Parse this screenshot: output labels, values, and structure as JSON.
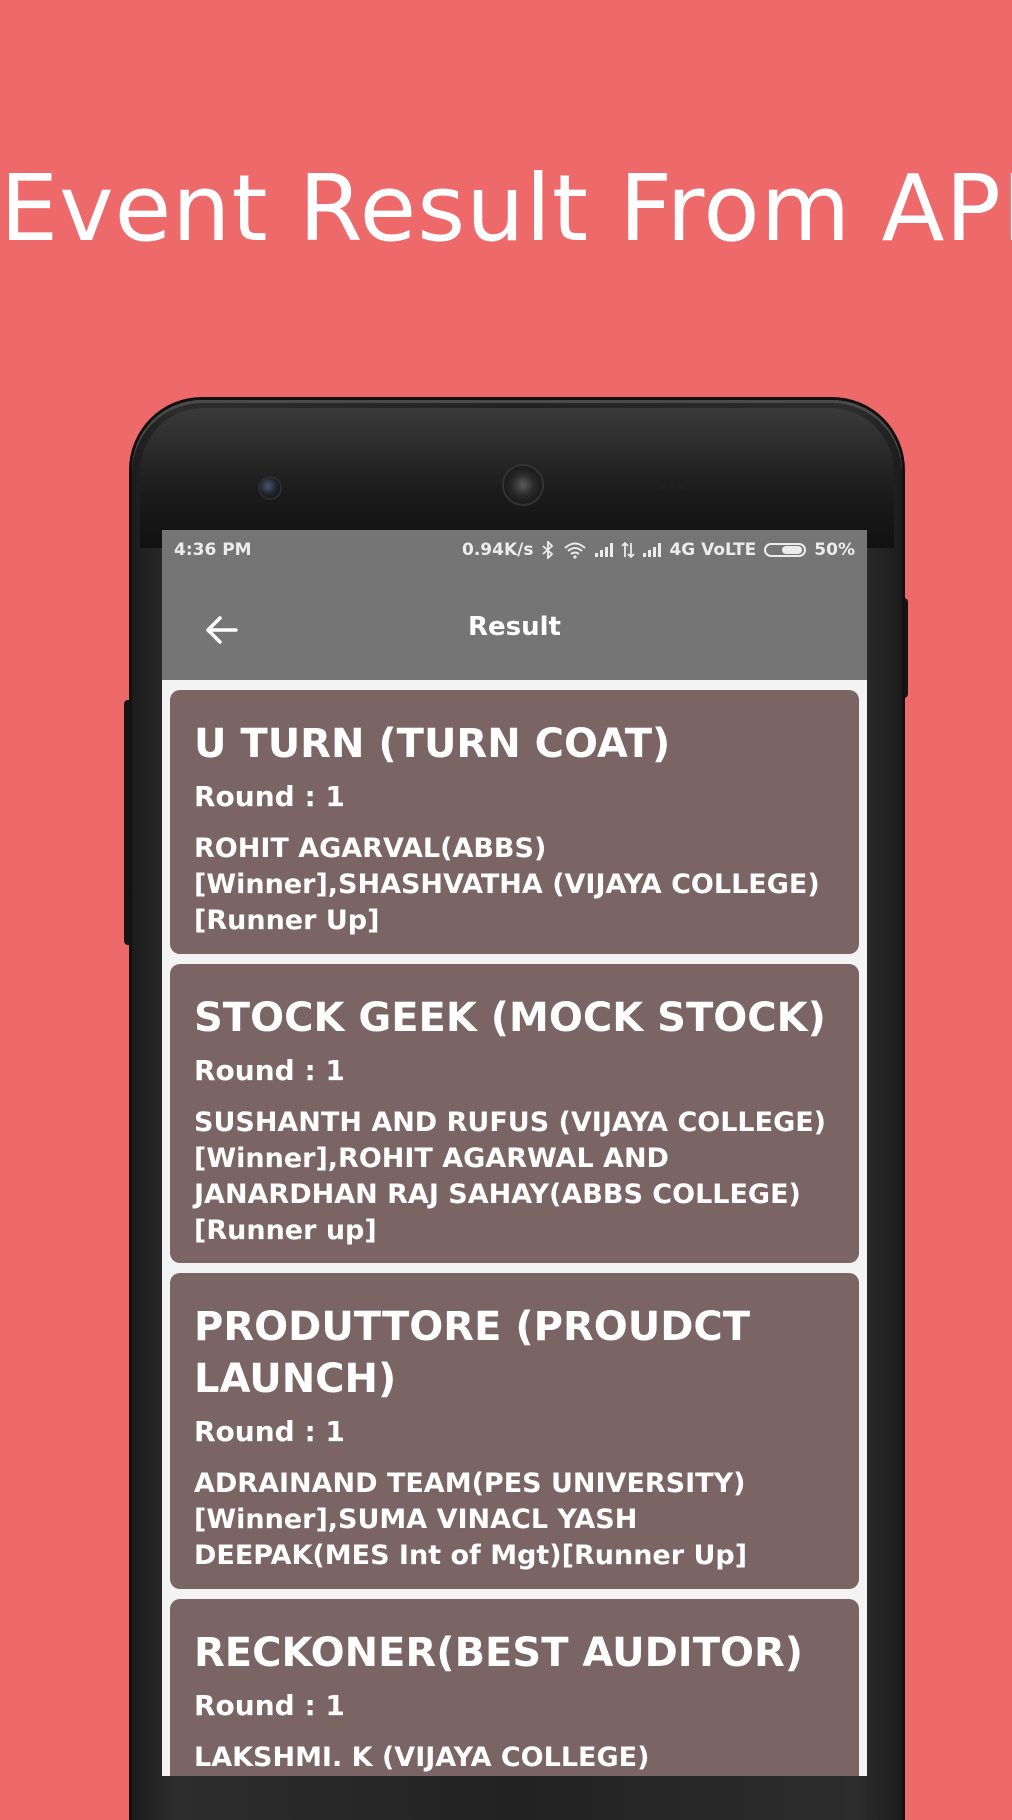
{
  "headline": "Event Result From API",
  "status_bar": {
    "time": "4:36 PM",
    "speed": "0.94K/s",
    "network": "4G VoLTE",
    "battery": "50%"
  },
  "app_bar": {
    "title": "Result",
    "back_icon": "arrow-left-icon"
  },
  "results": [
    {
      "title": "U TURN (TURN COAT)",
      "round": "Round : 1",
      "result": "ROHIT AGARVAL(ABBS) [Winner],SHASHVATHA (VIJAYA COLLEGE)[Runner Up]"
    },
    {
      "title": "STOCK GEEK (MOCK STOCK)",
      "round": "Round : 1",
      "result": "SUSHANTH AND RUFUS (VIJAYA COLLEGE)[Winner],ROHIT AGARWAL AND JANARDHAN RAJ SAHAY(ABBS COLLEGE)[Runner up]"
    },
    {
      "title": "PRODUTTORE (PROUDCT LAUNCH)",
      "round": "Round : 1",
      "result": "ADRAINAND TEAM(PES UNIVERSITY) [Winner],SUMA VINACL YASH DEEPAK(MES Int  of Mgt)[Runner Up]"
    },
    {
      "title": "RECKONER(BEST AUDITOR)",
      "round": "Round : 1",
      "result": "LAKSHMI. K (VIJAYA COLLEGE)"
    }
  ],
  "colors": {
    "background": "#ee6a6a",
    "app_bar": "#757575",
    "card": "#7b6464"
  }
}
